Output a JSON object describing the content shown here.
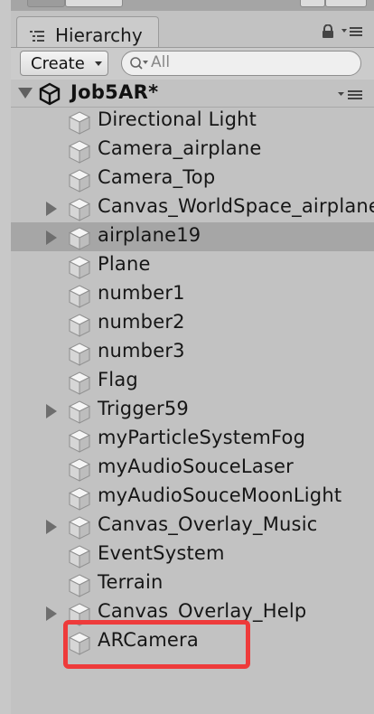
{
  "panel": {
    "tab_title": "Hierarchy",
    "tab_icon": "hierarchy-list-icon",
    "lock_icon": "lock-icon",
    "menu_icon": "menu-icon"
  },
  "toolbar": {
    "create_label": "Create",
    "search_placeholder": "All"
  },
  "scene": {
    "name": "Job5AR*",
    "icon": "unity-logo-icon"
  },
  "items": [
    {
      "label": "Directional Light",
      "expandable": false,
      "selected": false
    },
    {
      "label": "Camera_airplane",
      "expandable": false,
      "selected": false
    },
    {
      "label": "Camera_Top",
      "expandable": false,
      "selected": false
    },
    {
      "label": "Canvas_WorldSpace_airplane",
      "expandable": true,
      "selected": false
    },
    {
      "label": "airplane19",
      "expandable": true,
      "selected": true
    },
    {
      "label": "Plane",
      "expandable": false,
      "selected": false
    },
    {
      "label": "number1",
      "expandable": false,
      "selected": false
    },
    {
      "label": "number2",
      "expandable": false,
      "selected": false
    },
    {
      "label": "number3",
      "expandable": false,
      "selected": false
    },
    {
      "label": "Flag",
      "expandable": false,
      "selected": false
    },
    {
      "label": "Trigger59",
      "expandable": true,
      "selected": false
    },
    {
      "label": "myParticleSystemFog",
      "expandable": false,
      "selected": false
    },
    {
      "label": "myAudioSouceLaser",
      "expandable": false,
      "selected": false
    },
    {
      "label": "myAudioSouceMoonLight",
      "expandable": false,
      "selected": false
    },
    {
      "label": "Canvas_Overlay_Music",
      "expandable": true,
      "selected": false
    },
    {
      "label": "EventSystem",
      "expandable": false,
      "selected": false
    },
    {
      "label": "Terrain",
      "expandable": false,
      "selected": false
    },
    {
      "label": "Canvas_Overlay_Help",
      "expandable": true,
      "selected": false
    },
    {
      "label": "ARCamera",
      "expandable": false,
      "selected": false,
      "highlighted": true
    }
  ],
  "colors": {
    "highlight_border": "#ee3b3b",
    "selected_row": "#a6a6a6",
    "panel_bg": "#c2c2c2"
  }
}
